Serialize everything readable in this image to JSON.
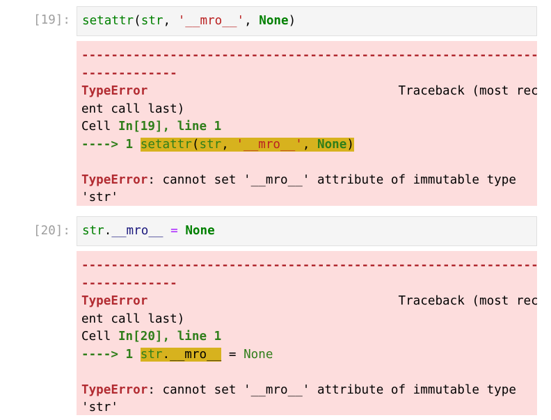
{
  "cells": [
    {
      "prompt": "[19]:",
      "input": {
        "fn": "setattr",
        "p1": "(",
        "arg": "str",
        "comma": ", ",
        "string": "'__mro__'",
        "comma2": ", ",
        "none": "None",
        "p2": ")"
      },
      "output": {
        "dash1": "--------------------------------------------------------------------",
        "dash2": "-------------",
        "err_name": "TypeError",
        "traceback_pad": "                                  ",
        "traceback_text": "Traceback (most rec",
        "tb_wrap": "ent call last)",
        "cell_prefix": "Cell ",
        "cell_ref": "In[19], line 1",
        "arrow": "----> 1 ",
        "code_fn": "setattr",
        "code_p1": "(",
        "code_arg": "str",
        "code_comma": ", ",
        "code_string": "'__mro__'",
        "code_comma2": ", ",
        "code_none": "None",
        "code_p2": ")",
        "err_msg_name": "TypeError",
        "err_msg": ": cannot set '__mro__' attribute of immutable type",
        "err_msg_wrap": "'str'"
      }
    },
    {
      "prompt": "[20]:",
      "input": {
        "obj": "str",
        "dot": ".",
        "attr": "__mro__",
        "eq": " = ",
        "none": "None"
      },
      "output": {
        "dash1": "--------------------------------------------------------------------",
        "dash2": "-------------",
        "err_name": "TypeError",
        "traceback_pad": "                                  ",
        "traceback_text": "Traceback (most rec",
        "tb_wrap": "ent call last)",
        "cell_prefix": "Cell ",
        "cell_ref": "In[20], line 1",
        "arrow": "----> 1 ",
        "code_obj": "str",
        "code_dot": ".",
        "code_attr": "__mro__",
        "code_eq": " = ",
        "code_none": "None",
        "err_msg_name": "TypeError",
        "err_msg": ": cannot set '__mro__' attribute of immutable type",
        "err_msg_wrap": "'str'"
      }
    }
  ]
}
